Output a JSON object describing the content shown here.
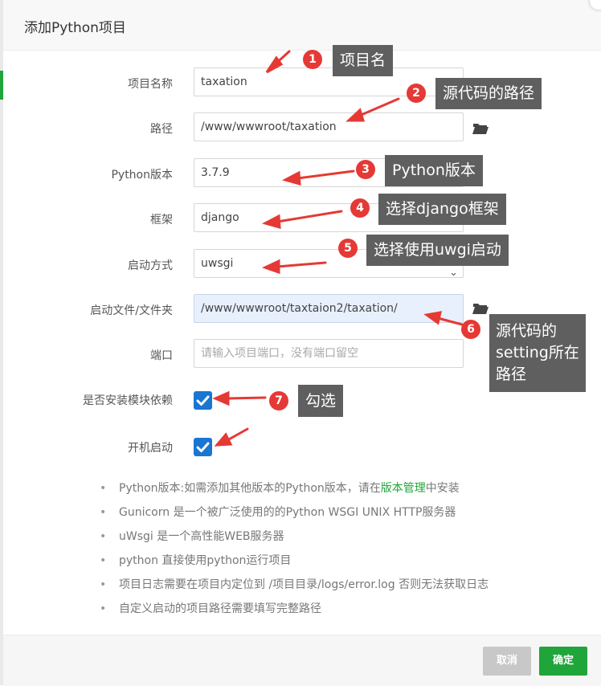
{
  "dialog": {
    "title": "添加Python项目"
  },
  "form": {
    "project_name": {
      "label": "项目名称",
      "value": "taxation"
    },
    "path": {
      "label": "路径",
      "value": "/www/wwwroot/taxation"
    },
    "python_version": {
      "label": "Python版本",
      "value": "3.7.9"
    },
    "framework": {
      "label": "框架",
      "value": "django"
    },
    "startup_method": {
      "label": "启动方式",
      "value": "uwsgi"
    },
    "startup_file": {
      "label": "启动文件/文件夹",
      "value": "/www/wwwroot/taxtaion2/taxation/"
    },
    "port": {
      "label": "端口",
      "placeholder": "请输入项目端口，没有端口留空"
    },
    "install_modules": {
      "label": "是否安装模块依赖",
      "checked": true
    },
    "auto_start": {
      "label": "开机启动",
      "checked": true
    }
  },
  "notes": {
    "n1_prefix": "Python版本:如需添加其他版本的Python版本，请在",
    "n1_link": "版本管理",
    "n1_suffix": "中安装",
    "n2": "Gunicorn 是一个被广泛使用的的Python WSGI UNIX HTTP服务器",
    "n3": "uWsgi 是一个高性能WEB服务器",
    "n4": "python 直接使用python运行项目",
    "n5": "项目日志需要在项目内定位到 /项目目录/logs/error.log 否则无法获取日志",
    "n6": "自定义启动的项目路径需要填写完整路径"
  },
  "buttons": {
    "cancel": "取消",
    "confirm": "确定"
  },
  "annotations": {
    "n1": "1",
    "t1": "项目名",
    "n2": "2",
    "t2": "源代码的路径",
    "n3": "3",
    "t3": "Python版本",
    "n4": "4",
    "t4": "选择django框架",
    "n5": "5",
    "t5": "选择使用uwgi启动",
    "n6": "6",
    "t6": "源代码的setting所在路径",
    "n7": "7",
    "t7": "勾选"
  },
  "colors": {
    "accent_green": "#20a53a",
    "annotation_red": "#e53935",
    "checkbox_blue": "#1976d2",
    "callout_bg": "#5f5f5f"
  }
}
